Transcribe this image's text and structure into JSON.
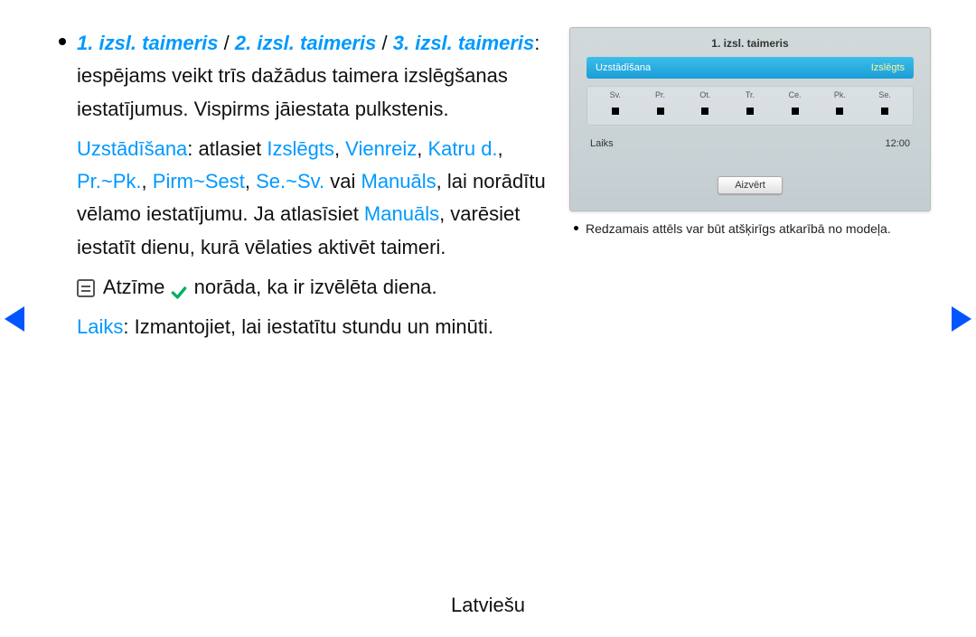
{
  "text": {
    "timer1": "1. izsl. taimeris",
    "sep": " / ",
    "timer2": "2. izsl. taimeris",
    "timer3": "3. izsl. taimeris",
    "intro": ": iespējams veikt trīs dažādus taimera izslēgšanas iestatījumus. Vispirms jāiestata pulkstenis.",
    "setup_label": "Uzstādīšana",
    "setup_after": ": atlasiet ",
    "off": "Izslēgts",
    "comma": ", ",
    "once": "Vienreiz",
    "daily": "Katru d.",
    "monfri": "Pr.~Pk.",
    "monsat": "Pirm~Sest",
    "satsun": "Se.~Sv.",
    "or": " vai ",
    "manual": "Manuāls",
    "manual2": "Manuāls",
    "setup_tail1": ", lai norādītu vēlamo iestatījumu. Ja atlasīsiet ",
    "setup_tail2": ", varēsiet iestatīt dienu, kurā vēlaties aktivēt taimeri.",
    "note_pre": " Atzīme ",
    "note_post": " norāda, ka ir izvēlēta diena.",
    "laiks_label": "Laiks",
    "laiks_text": ": Izmantojiet, lai iestatītu stundu un minūti."
  },
  "preview": {
    "title": "1. izsl. taimeris",
    "setup_label": "Uzstādīšana",
    "setup_value": "Izslēgts",
    "days": [
      "Sv.",
      "Pr.",
      "Ot.",
      "Tr.",
      "Ce.",
      "Pk.",
      "Se."
    ],
    "time_label": "Laiks",
    "time_value": "12:00",
    "close": "Aizvērt"
  },
  "caption": "Redzamais attēls var būt atšķirīgs atkarībā no modeļa.",
  "footer": "Latviešu"
}
